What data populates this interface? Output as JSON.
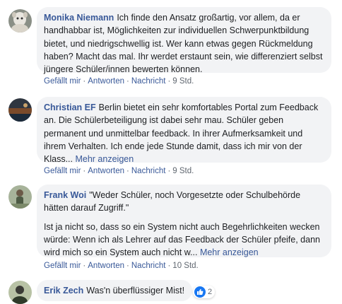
{
  "comments": [
    {
      "author": "Monika Niemann",
      "text": "Ich finde den Ansatz großartig, vor allem, da er handhabbar ist, Möglichkeiten zur individuellen Schwerpunktbildung bietet, und niedrigschwellig ist. Wer kann etwas gegen Rückmeldung haben? Macht das mal. Ihr werdet erstaunt sein, wie differenziert selbst jüngere Schüler/innen bewerten können.",
      "actions": {
        "like": "Gefällt mir",
        "reply": "Antworten",
        "message": "Nachricht",
        "time": "9 Std."
      }
    },
    {
      "author": "Christian EF",
      "text": "Berlin bietet ein sehr komfortables Portal zum Feedback an. Die Schülerbeteiligung ist dabei sehr mau. Schüler geben permanent und unmittelbar feedback. In ihrer Aufmerksamkeit und ihrem Verhalten. Ich ende jede Stunde damit, dass ich mir von der Klass...",
      "more": "Mehr anzeigen",
      "actions": {
        "like": "Gefällt mir",
        "reply": "Antworten",
        "message": "Nachricht",
        "time": "9 Std."
      }
    },
    {
      "author": "Frank Woi",
      "text": "\"Weder Schüler, noch Vorgesetzte oder Schulbehörde hätten darauf Zugriff.\"",
      "text2": "Ist ja nicht so, dass so ein System nicht auch Begehrlichkeiten wecken würde: Wenn ich als Lehrer auf das Feedback der Schüler pfeife, dann wird mich so ein System auch nicht w...",
      "more": "Mehr anzeigen",
      "actions": {
        "like": "Gefällt mir",
        "reply": "Antworten",
        "message": "Nachricht",
        "time": "10 Std."
      }
    },
    {
      "author": "Erik Zech",
      "text": "Was'n überflüssiger Mist!",
      "reaction_count": "2"
    }
  ],
  "colors": {
    "link": "#385898",
    "bubble": "#f2f3f5",
    "meta": "#606770",
    "like_blue": "#1877f2"
  },
  "icons": [
    "thumbs-up-icon",
    "dot-separator-icon"
  ]
}
